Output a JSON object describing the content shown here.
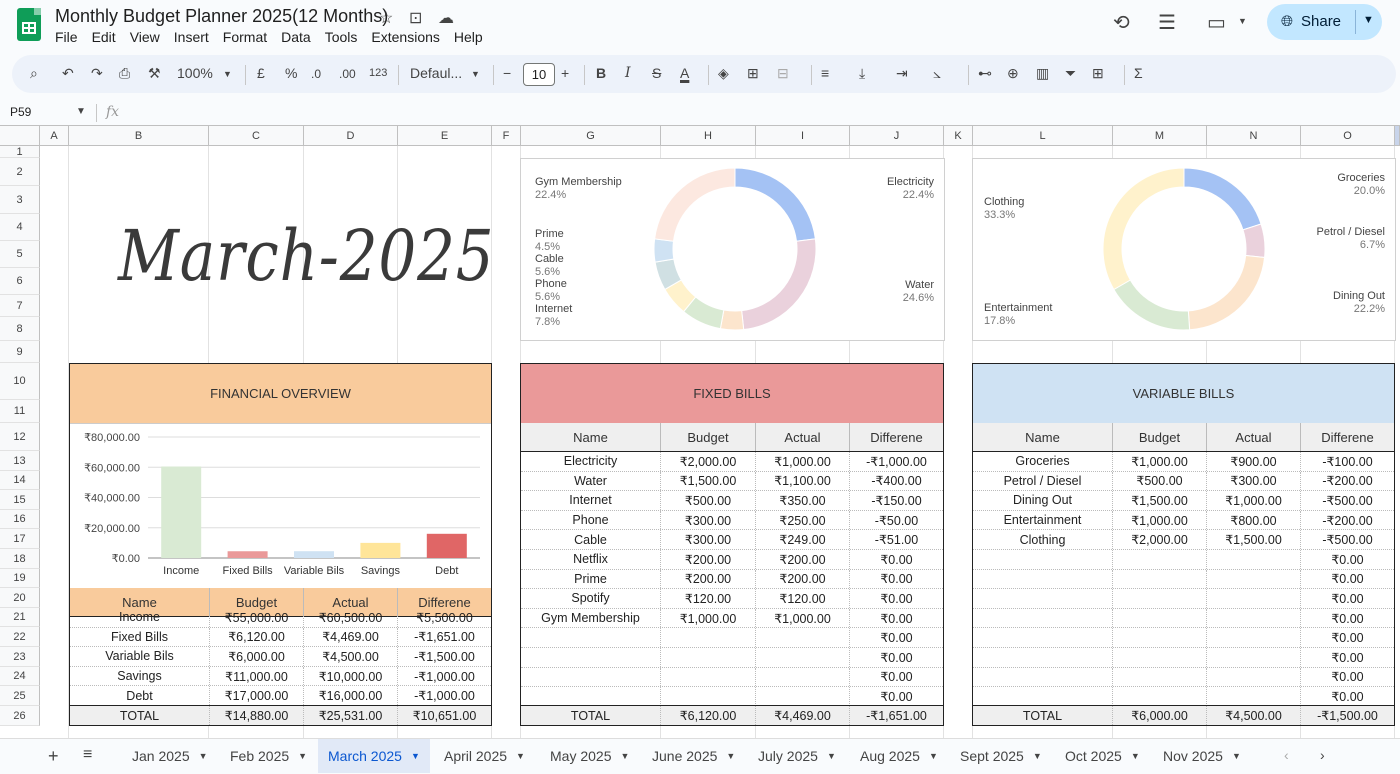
{
  "app": {
    "title": "Monthly Budget Planner 2025(12 Months)",
    "menu": [
      "File",
      "Edit",
      "View",
      "Insert",
      "Format",
      "Data",
      "Tools",
      "Extensions",
      "Help"
    ],
    "share_label": "Share"
  },
  "toolbar": {
    "zoom": "100%",
    "currency": "£",
    "percent": "%",
    "dec_decrease": ".0",
    "dec_increase": ".00",
    "number_format": "123",
    "font": "Defaul...",
    "font_size": "10"
  },
  "formula_bar": {
    "cell_ref": "P59",
    "fx": "fx"
  },
  "columns": [
    "A",
    "B",
    "C",
    "D",
    "E",
    "F",
    "G",
    "H",
    "I",
    "J",
    "K",
    "L",
    "M",
    "N",
    "O"
  ],
  "rows": [
    "1",
    "2",
    "3",
    "4",
    "5",
    "6",
    "7",
    "8",
    "9",
    "10",
    "11",
    "12",
    "13",
    "14",
    "15",
    "16",
    "17",
    "18",
    "19",
    "20",
    "21",
    "22",
    "23",
    "24",
    "25",
    "26"
  ],
  "month_title": "March-2025",
  "fixed_pie": {
    "labels": [
      {
        "name": "Gym Membership",
        "pct": "22.4%"
      },
      {
        "name": "Electricity",
        "pct": "22.4%"
      },
      {
        "name": "Prime",
        "pct": "4.5%"
      },
      {
        "name": "Cable",
        "pct": "5.6%"
      },
      {
        "name": "Phone",
        "pct": "5.6%"
      },
      {
        "name": "Internet",
        "pct": "7.8%"
      },
      {
        "name": "Water",
        "pct": "24.6%"
      }
    ]
  },
  "variable_pie": {
    "labels": [
      {
        "name": "Groceries",
        "pct": "20.0%"
      },
      {
        "name": "Clothing",
        "pct": "33.3%"
      },
      {
        "name": "Petrol / Diesel",
        "pct": "6.7%"
      },
      {
        "name": "Entertainment",
        "pct": "17.8%"
      },
      {
        "name": "Dining Out",
        "pct": "22.2%"
      }
    ]
  },
  "financial_overview": {
    "title": "FINANCIAL OVERVIEW",
    "headers": [
      "Name",
      "Budget",
      "Actual",
      "Differene"
    ],
    "rows": [
      [
        "Income",
        "₹55,000.00",
        "₹60,500.00",
        "₹5,500.00"
      ],
      [
        "Fixed Bills",
        "₹6,120.00",
        "₹4,469.00",
        "-₹1,651.00"
      ],
      [
        "Variable Bils",
        "₹6,000.00",
        "₹4,500.00",
        "-₹1,500.00"
      ],
      [
        "Savings",
        "₹11,000.00",
        "₹10,000.00",
        "-₹1,000.00"
      ],
      [
        "Debt",
        "₹17,000.00",
        "₹16,000.00",
        "-₹1,000.00"
      ]
    ],
    "total": [
      "TOTAL",
      "₹14,880.00",
      "₹25,531.00",
      "₹10,651.00"
    ]
  },
  "fixed_bills": {
    "title": "FIXED BILLS",
    "headers": [
      "Name",
      "Budget",
      "Actual",
      "Differene"
    ],
    "rows": [
      [
        "Electricity",
        "₹2,000.00",
        "₹1,000.00",
        "-₹1,000.00"
      ],
      [
        "Water",
        "₹1,500.00",
        "₹1,100.00",
        "-₹400.00"
      ],
      [
        "Internet",
        "₹500.00",
        "₹350.00",
        "-₹150.00"
      ],
      [
        "Phone",
        "₹300.00",
        "₹250.00",
        "-₹50.00"
      ],
      [
        "Cable",
        "₹300.00",
        "₹249.00",
        "-₹51.00"
      ],
      [
        "Netflix",
        "₹200.00",
        "₹200.00",
        "₹0.00"
      ],
      [
        "Prime",
        "₹200.00",
        "₹200.00",
        "₹0.00"
      ],
      [
        "Spotify",
        "₹120.00",
        "₹120.00",
        "₹0.00"
      ],
      [
        "Gym Membership",
        "₹1,000.00",
        "₹1,000.00",
        "₹0.00"
      ],
      [
        "",
        "",
        "",
        "₹0.00"
      ],
      [
        "",
        "",
        "",
        "₹0.00"
      ],
      [
        "",
        "",
        "",
        "₹0.00"
      ],
      [
        "",
        "",
        "",
        "₹0.00"
      ]
    ],
    "total": [
      "TOTAL",
      "₹6,120.00",
      "₹4,469.00",
      "-₹1,651.00"
    ]
  },
  "variable_bills": {
    "title": "VARIABLE BILLS",
    "headers": [
      "Name",
      "Budget",
      "Actual",
      "Differene"
    ],
    "rows": [
      [
        "Groceries",
        "₹1,000.00",
        "₹900.00",
        "-₹100.00"
      ],
      [
        "Petrol / Diesel",
        "₹500.00",
        "₹300.00",
        "-₹200.00"
      ],
      [
        "Dining Out",
        "₹1,500.00",
        "₹1,000.00",
        "-₹500.00"
      ],
      [
        "Entertainment",
        "₹1,000.00",
        "₹800.00",
        "-₹200.00"
      ],
      [
        "Clothing",
        "₹2,000.00",
        "₹1,500.00",
        "-₹500.00"
      ],
      [
        "",
        "",
        "",
        "₹0.00"
      ],
      [
        "",
        "",
        "",
        "₹0.00"
      ],
      [
        "",
        "",
        "",
        "₹0.00"
      ],
      [
        "",
        "",
        "",
        "₹0.00"
      ],
      [
        "",
        "",
        "",
        "₹0.00"
      ],
      [
        "",
        "",
        "",
        "₹0.00"
      ],
      [
        "",
        "",
        "",
        "₹0.00"
      ],
      [
        "",
        "",
        "",
        "₹0.00"
      ]
    ],
    "total": [
      "TOTAL",
      "₹6,000.00",
      "₹4,500.00",
      "-₹1,500.00"
    ]
  },
  "sheet_tabs": [
    "Jan 2025",
    "Feb 2025",
    "March 2025",
    "April 2025",
    "May 2025",
    "June 2025",
    "July 2025",
    "Aug 2025",
    "Sept 2025",
    "Oct 2025",
    "Nov 2025"
  ],
  "active_tab": "March 2025",
  "chart_data": [
    {
      "type": "bar",
      "categories": [
        "Income",
        "Fixed Bills",
        "Variable Bils",
        "Savings",
        "Debt"
      ],
      "values": [
        60500,
        4469,
        4500,
        10000,
        16000
      ],
      "colors": [
        "#d9ead3",
        "#ea9999",
        "#cfe2f3",
        "#ffe599",
        "#e06666"
      ],
      "ytick_labels": [
        "₹80,000.00",
        "₹60,000.00",
        "₹40,000.00",
        "₹20,000.00",
        "₹0.00"
      ],
      "ylim": [
        0,
        80000
      ]
    },
    {
      "type": "pie",
      "categories": [
        "Electricity",
        "Water",
        "Netflix",
        "Internet",
        "Phone",
        "Cable",
        "Prime",
        "Gym Membership"
      ],
      "values": [
        1000,
        1100,
        200,
        350,
        250,
        249,
        200,
        1000
      ],
      "colors": [
        "#a4c2f4",
        "#ead1dc",
        "#fce5cd",
        "#d9ead3",
        "#fff2cc",
        "#d0e0e3",
        "#cfe2f3",
        "#fce8e0"
      ]
    },
    {
      "type": "pie",
      "categories": [
        "Groceries",
        "Petrol / Diesel",
        "Dining Out",
        "Entertainment",
        "Clothing"
      ],
      "values": [
        900,
        300,
        1000,
        800,
        1500
      ],
      "colors": [
        "#a4c2f4",
        "#ead1dc",
        "#fce5cd",
        "#d9ead3",
        "#fff2cc"
      ]
    }
  ]
}
